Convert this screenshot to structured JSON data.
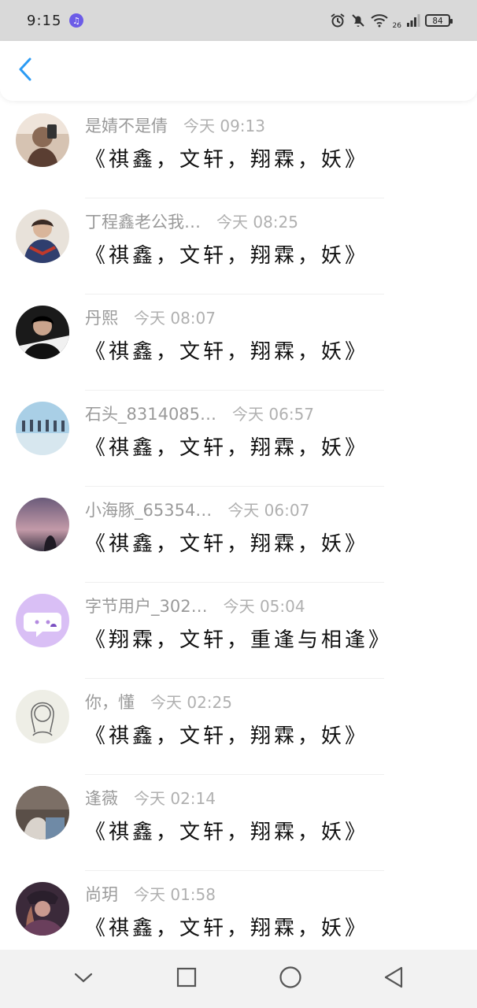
{
  "status_bar": {
    "time": "9:15",
    "network": "26",
    "battery": "84"
  },
  "icons": {
    "back": "chevron-left-icon",
    "music": "music-note-icon",
    "alarm": "alarm-icon",
    "mute": "bell-off-icon",
    "wifi": "wifi-icon",
    "signal": "signal-icon",
    "battery": "battery-icon"
  },
  "colors": {
    "accent": "#2b9bf4",
    "status_bar_bg": "#d9d9d9",
    "nav_bar_bg": "#f2f2f2",
    "name_gray": "#9a9a9a"
  },
  "items": [
    {
      "name": "是婧不是倩",
      "time": "今天 09:13",
      "title": "《祺鑫，文轩，翔霖，妖》"
    },
    {
      "name": "丁程鑫老公我…",
      "time": "今天 08:25",
      "title": "《祺鑫，文轩，翔霖，妖》"
    },
    {
      "name": "丹熙",
      "time": "今天 08:07",
      "title": "《祺鑫，文轩，翔霖，妖》"
    },
    {
      "name": "石头_8314085…",
      "time": "今天 06:57",
      "title": "《祺鑫，文轩，翔霖，妖》"
    },
    {
      "name": "小海豚_65354…",
      "time": "今天 06:07",
      "title": "《祺鑫，文轩，翔霖，妖》"
    },
    {
      "name": "字节用户_302…",
      "time": "今天 05:04",
      "title": "《翔霖，文轩，重逢与相逢》"
    },
    {
      "name": "你，懂",
      "time": "今天 02:25",
      "title": "《祺鑫，文轩，翔霖，妖》"
    },
    {
      "name": "逢薇",
      "time": "今天 02:14",
      "title": "《祺鑫，文轩，翔霖，妖》"
    },
    {
      "name": "尚玥",
      "time": "今天 01:58",
      "title": "《祺鑫，文轩，翔霖，妖》"
    }
  ]
}
